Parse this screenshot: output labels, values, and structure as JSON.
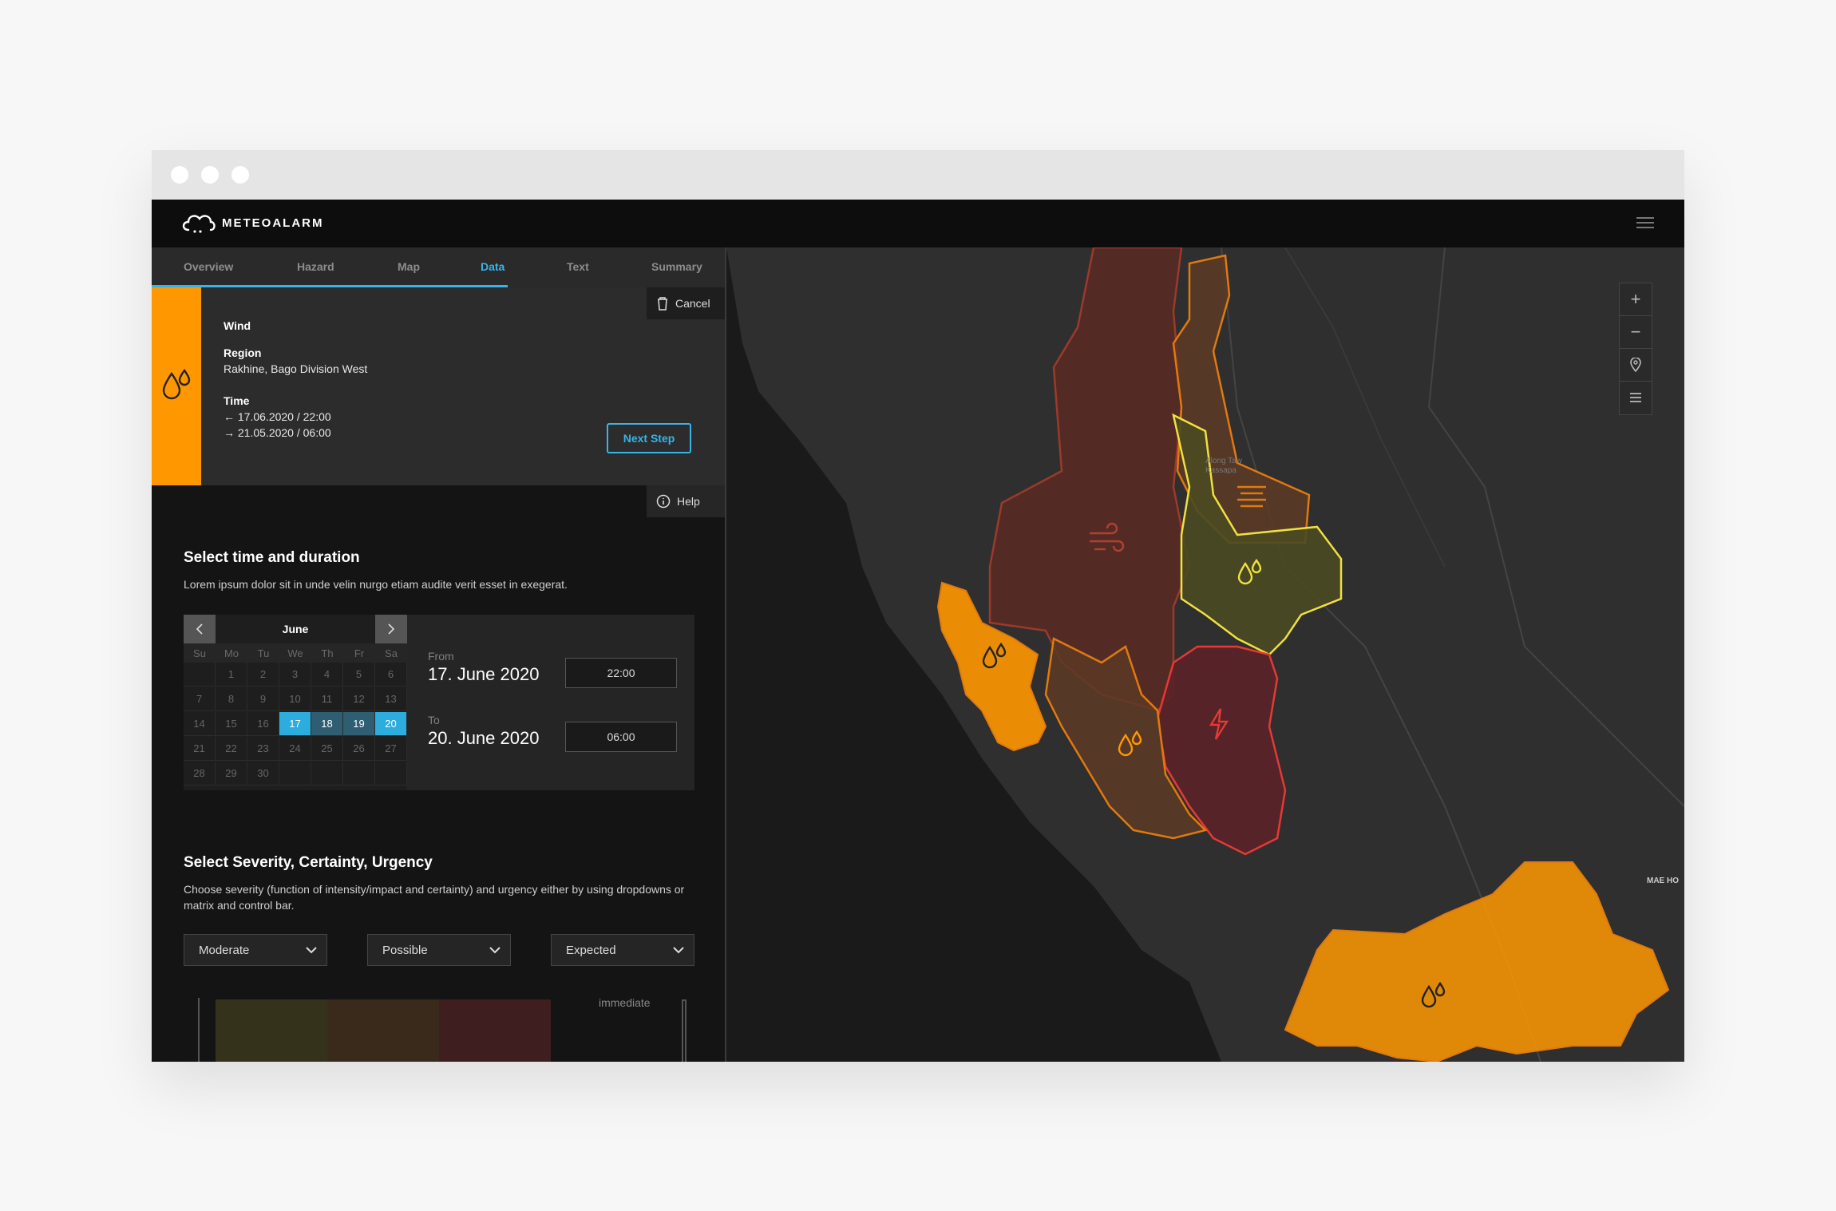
{
  "app": {
    "name": "METEOALARM"
  },
  "tabs": [
    {
      "label": "Overview"
    },
    {
      "label": "Hazard"
    },
    {
      "label": "Map"
    },
    {
      "label": "Data"
    },
    {
      "label": "Text"
    },
    {
      "label": "Summary"
    }
  ],
  "active_tab": "Data",
  "summary": {
    "hazard": "Wind",
    "region_label": "Region",
    "region_value": "Rakhine, Bago Division West",
    "time_label": "Time",
    "time_from": "← 17.06.2020 / 22:00",
    "time_to": "→ 21.05.2020 / 06:00",
    "cancel_label": "Cancel",
    "next_label": "Next Step",
    "help_label": "Help",
    "accent": "#ff9800"
  },
  "time_section": {
    "title": "Select time and duration",
    "description": "Lorem ipsum dolor sit in unde velin nurgo etiam audite verit esset in exegerat."
  },
  "calendar": {
    "month": "June",
    "weekdays": [
      "Su",
      "Mo",
      "Tu",
      "We",
      "Th",
      "Fr",
      "Sa"
    ],
    "weeks": [
      [
        "",
        "1",
        "2",
        "3",
        "4",
        "5",
        "6"
      ],
      [
        "7",
        "8",
        "9",
        "10",
        "11",
        "12",
        "13"
      ],
      [
        "14",
        "15",
        "16",
        "17",
        "18",
        "19",
        "20"
      ],
      [
        "21",
        "22",
        "23",
        "24",
        "25",
        "26",
        "27"
      ],
      [
        "28",
        "29",
        "30",
        "",
        "",
        "",
        ""
      ]
    ],
    "selected": [
      "17",
      "20"
    ],
    "in_range": [
      "18",
      "19"
    ]
  },
  "range": {
    "from_label": "From",
    "from_date": "17. June 2020",
    "from_time": "22:00",
    "to_label": "To",
    "to_date": "20. June 2020",
    "to_time": "06:00"
  },
  "severity_section": {
    "title": "Select Severity, Certainty, Urgency",
    "description": "Choose severity (function of intensity/impact and certainty) and urgency either by using dropdowns or matrix and control bar.",
    "severity": "Moderate",
    "certainty": "Possible",
    "urgency": "Expected",
    "urgency_axis_label": "immediate"
  },
  "map": {
    "labels": [
      "Along Taw Kassapa",
      "MAE HO"
    ],
    "colors": {
      "orange": "#ff9800",
      "red": "#e53935",
      "yellow": "#ffeb3b",
      "brown": "#8a3a2a"
    }
  }
}
